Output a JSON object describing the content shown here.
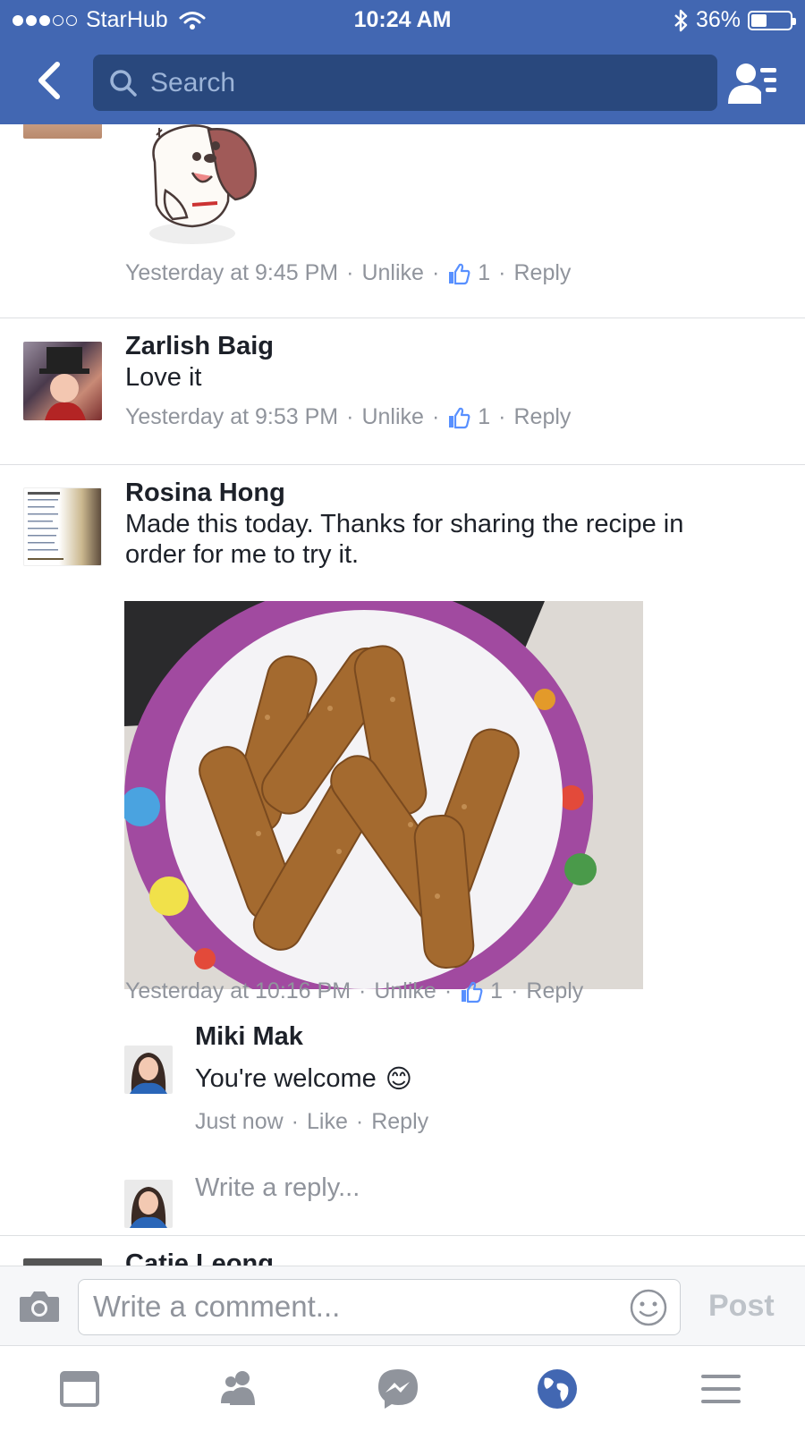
{
  "status_bar": {
    "carrier": "StarHub",
    "time": "10:24 AM",
    "battery": "36%"
  },
  "header": {
    "search_placeholder": "Search"
  },
  "comments": [
    {
      "id": "sticker-comment",
      "time": "Yesterday at 9:45 PM",
      "action": "Unlike",
      "likes": "1",
      "reply": "Reply"
    },
    {
      "id": "zarlish",
      "author": "Zarlish Baig",
      "text": "Love it",
      "time": "Yesterday at 9:53 PM",
      "action": "Unlike",
      "likes": "1",
      "reply": "Reply"
    },
    {
      "id": "rosina",
      "author": "Rosina Hong",
      "text_line1": "Made this today. Thanks for sharing the recipe in",
      "text_line2": "order for me to try it.",
      "time": "Yesterday at 10:16 PM",
      "action": "Unlike",
      "likes": "1",
      "reply": "Reply"
    }
  ],
  "reply": {
    "author": "Miki Mak",
    "text": "You're welcome",
    "emoji": "😊",
    "time": "Just now",
    "action": "Like",
    "reply": "Reply"
  },
  "reply_input": {
    "placeholder": "Write a reply..."
  },
  "partial_next_author": "Catie Leong",
  "comment_bar": {
    "placeholder": "Write a comment...",
    "post_label": "Post"
  },
  "tabs": [
    "news-feed",
    "requests",
    "messenger",
    "notifications",
    "more"
  ],
  "colors": {
    "brand": "#4267b2",
    "search_bg": "#29487d",
    "meta_gray": "#90949c",
    "like_blue": "#5890ff"
  }
}
